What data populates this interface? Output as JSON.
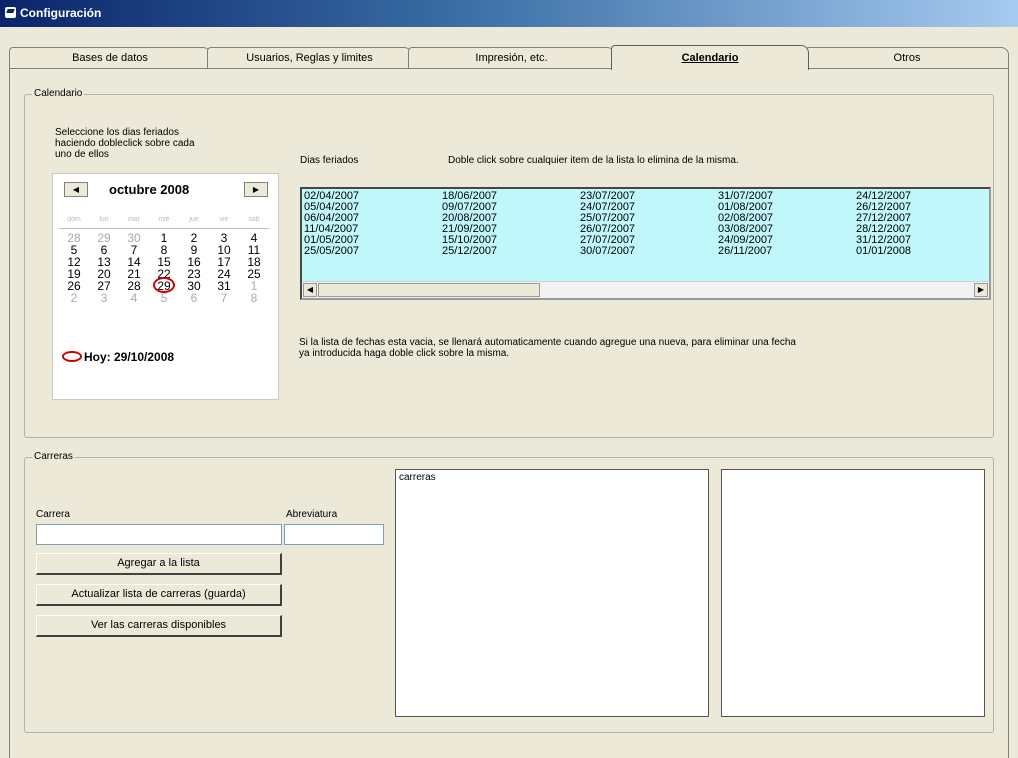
{
  "window": {
    "title": "Configuración"
  },
  "tabs": [
    {
      "label": "Bases de datos"
    },
    {
      "label": "Usuarios, Reglas y limites"
    },
    {
      "label": "Impresión, etc."
    },
    {
      "label": "Calendario"
    },
    {
      "label": "Otros"
    }
  ],
  "calendar_group": {
    "title": "Calendario",
    "instructions": [
      "Seleccione los dias feriados",
      "haciendo dobleclick sobre cada",
      "uno de ellos"
    ],
    "holidays_label": "Dias feriados",
    "holidays_hint": "Doble click sobre cualquier item de la lista lo elimina de la misma.",
    "holidays": [
      [
        "02/04/2007",
        "05/04/2007",
        "06/04/2007",
        "11/04/2007",
        "01/05/2007",
        "25/05/2007"
      ],
      [
        "18/06/2007",
        "09/07/2007",
        "20/08/2007",
        "21/09/2007",
        "15/10/2007",
        "25/12/2007"
      ],
      [
        "23/07/2007",
        "24/07/2007",
        "25/07/2007",
        "26/07/2007",
        "27/07/2007",
        "30/07/2007"
      ],
      [
        "31/07/2007",
        "01/08/2007",
        "02/08/2007",
        "03/08/2007",
        "24/09/2007",
        "26/11/2007"
      ],
      [
        "24/12/2007",
        "26/12/2007",
        "27/12/2007",
        "28/12/2007",
        "31/12/2007",
        "01/01/2008"
      ]
    ],
    "note": [
      "Si la lista de fechas esta vacia, se llenará automaticamente cuando agregue una nueva, para eliminar una fecha",
      "ya introducida haga doble click sobre la misma."
    ]
  },
  "month_calendar": {
    "month_label": "octubre 2008",
    "prev_icon": "left-arrow",
    "next_icon": "right-arrow",
    "weekdays": [
      "dom",
      "lun",
      "mar",
      "mié",
      "jue",
      "vie",
      "sáb"
    ],
    "weeks": [
      [
        "28",
        "29",
        "30",
        "1",
        "2",
        "3",
        "4"
      ],
      [
        "5",
        "6",
        "7",
        "8",
        "9",
        "10",
        "11"
      ],
      [
        "12",
        "13",
        "14",
        "15",
        "16",
        "17",
        "18"
      ],
      [
        "19",
        "20",
        "21",
        "22",
        "23",
        "24",
        "25"
      ],
      [
        "26",
        "27",
        "28",
        "29",
        "30",
        "31",
        "1"
      ],
      [
        "2",
        "3",
        "4",
        "5",
        "6",
        "7",
        "8"
      ]
    ],
    "today_label": "Hoy: 29/10/2008"
  },
  "careers_group": {
    "title": "Carreras",
    "career_label": "Carrera",
    "career_value": "",
    "abbr_label": "Abreviatura",
    "abbr_value": "",
    "add_button": "Agregar a la lista",
    "update_button": "Actualizar lista de carreras (guarda)",
    "view_button": "Ver las carreras disponibles",
    "list_header": "carreras",
    "second_list": []
  },
  "colors": {
    "holidays_bg": "#bff7fb",
    "today_circle": "#cc0000",
    "titlebar": "#0a246a",
    "face": "#ece9d8"
  }
}
